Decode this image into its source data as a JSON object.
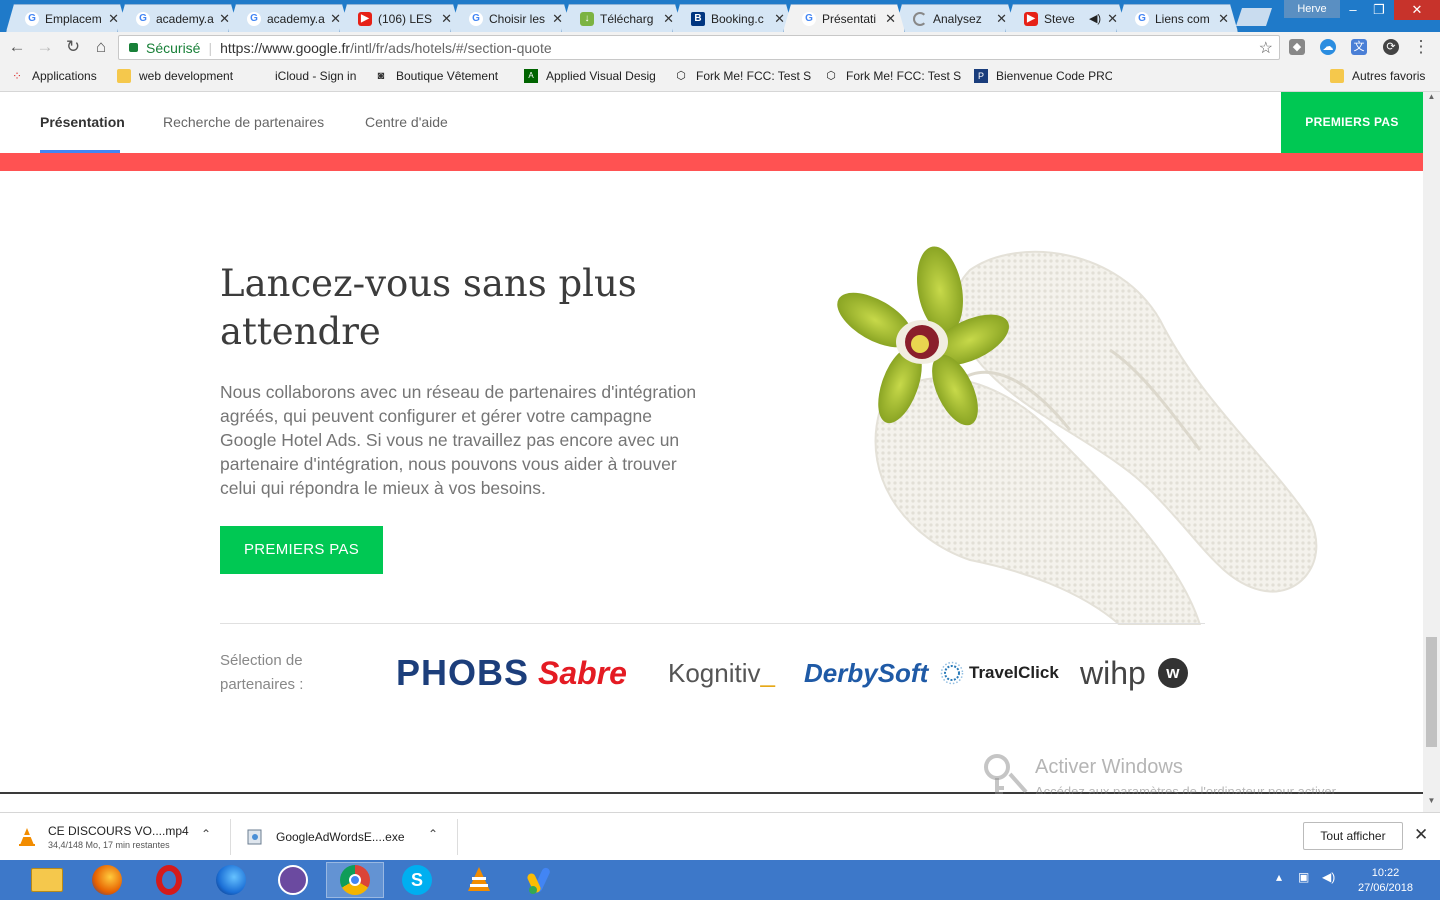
{
  "browser": {
    "tabs": [
      {
        "title": "Emplacem",
        "icon": "google-icon"
      },
      {
        "title": "academy.a",
        "icon": "google-icon"
      },
      {
        "title": "academy.a",
        "icon": "google-icon"
      },
      {
        "title": "(106) LES",
        "icon": "youtube-icon"
      },
      {
        "title": "Choisir les",
        "icon": "google-icon"
      },
      {
        "title": "Télécharg",
        "icon": "android-icon"
      },
      {
        "title": "Booking.c",
        "icon": "booking-icon"
      },
      {
        "title": "Présentati",
        "icon": "google-icon",
        "active": true
      },
      {
        "title": "Analysez",
        "icon": "loading-icon"
      },
      {
        "title": "Steve",
        "icon": "youtube-icon",
        "audio": true
      },
      {
        "title": "Liens com",
        "icon": "google-icon"
      }
    ],
    "profile_name": "Herve",
    "address": {
      "secure_label": "Sécurisé",
      "url_host": "https://www.google.fr",
      "url_path": "/intl/fr/ads/hotels/#/section-quote"
    },
    "bookmarks": [
      {
        "label": "Applications",
        "icon": "apps-grid-icon"
      },
      {
        "label": "web development",
        "icon": "folder-icon"
      },
      {
        "label": "iCloud - Sign in",
        "icon": "apple-icon"
      },
      {
        "label": "Boutique Vêtement",
        "icon": "camera-icon"
      },
      {
        "label": "Applied Visual Desig",
        "icon": "fcc-icon"
      },
      {
        "label": "Fork Me! FCC: Test S",
        "icon": "codepen-icon"
      },
      {
        "label": "Fork Me! FCC: Test S",
        "icon": "codepen-icon"
      },
      {
        "label": "Bienvenue Code PRO",
        "icon": "codepro-icon"
      },
      {
        "label": "Autres favoris",
        "icon": "folder-icon"
      }
    ]
  },
  "site": {
    "nav": [
      {
        "label": "Présentation",
        "active": true
      },
      {
        "label": "Recherche de partenaires"
      },
      {
        "label": "Centre d'aide"
      }
    ],
    "nav_cta": "PREMIERS PAS",
    "headline": "Lancez-vous sans plus attendre",
    "body": "Nous collaborons avec un réseau de partenaires d'intégration agréés, qui peuvent configurer et gérer votre campagne Google Hotel Ads. Si vous ne travaillez pas encore avec un partenaire d'intégration, nous pouvons vous aider à trouver celui qui répondra le mieux à vos besoins.",
    "cta": "PREMIERS PAS",
    "partners_label": "Sélection de partenaires :",
    "partners": [
      "PHOBS",
      "Sabre",
      "Kognitiv",
      "DerbySoft",
      "TravelClick",
      "wihp"
    ],
    "kognitiv_underscore": "_",
    "wihp_badge": "w",
    "colors": {
      "green": "#00c853",
      "red_band": "#ff5252",
      "nav_underline": "#4285f4"
    }
  },
  "windows_watermark": {
    "title": "Activer Windows",
    "subtitle": "Accédez aux paramètres de l'ordinateur pour activer Windows."
  },
  "downloads": [
    {
      "name": "CE DISCOURS VO....mp4",
      "status": "34,4/148 Mo, 17 min restantes",
      "icon": "vlc-icon"
    },
    {
      "name": "GoogleAdWordsE....exe",
      "status": "",
      "icon": "installer-icon"
    }
  ],
  "download_show_all": "Tout afficher",
  "taskbar": {
    "apps": [
      "file-explorer-icon",
      "firefox-icon",
      "opera-icon",
      "firefox-dev-icon",
      "cat-app-icon",
      "chrome-icon",
      "skype-icon",
      "vlc-icon",
      "adwords-icon"
    ],
    "time": "10:22",
    "date": "27/06/2018"
  }
}
